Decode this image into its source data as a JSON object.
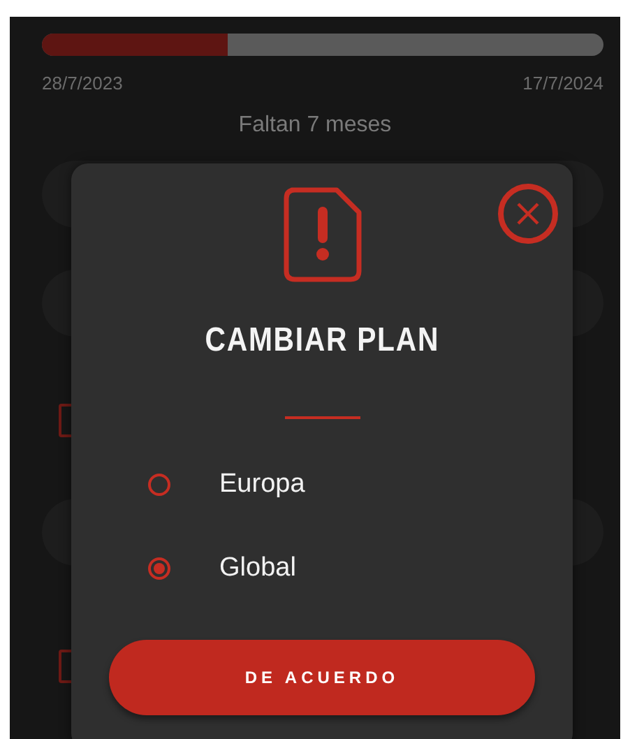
{
  "progress": {
    "level": 0.33,
    "start_date": "28/7/2023",
    "end_date": "17/7/2024",
    "remaining": "Faltan 7 meses"
  },
  "dialog": {
    "title": "CAMBIAR PLAN",
    "options": [
      {
        "label": "Europa",
        "selected": false
      },
      {
        "label": "Global",
        "selected": true
      }
    ],
    "confirm_button": "DE ACUERDO"
  }
}
